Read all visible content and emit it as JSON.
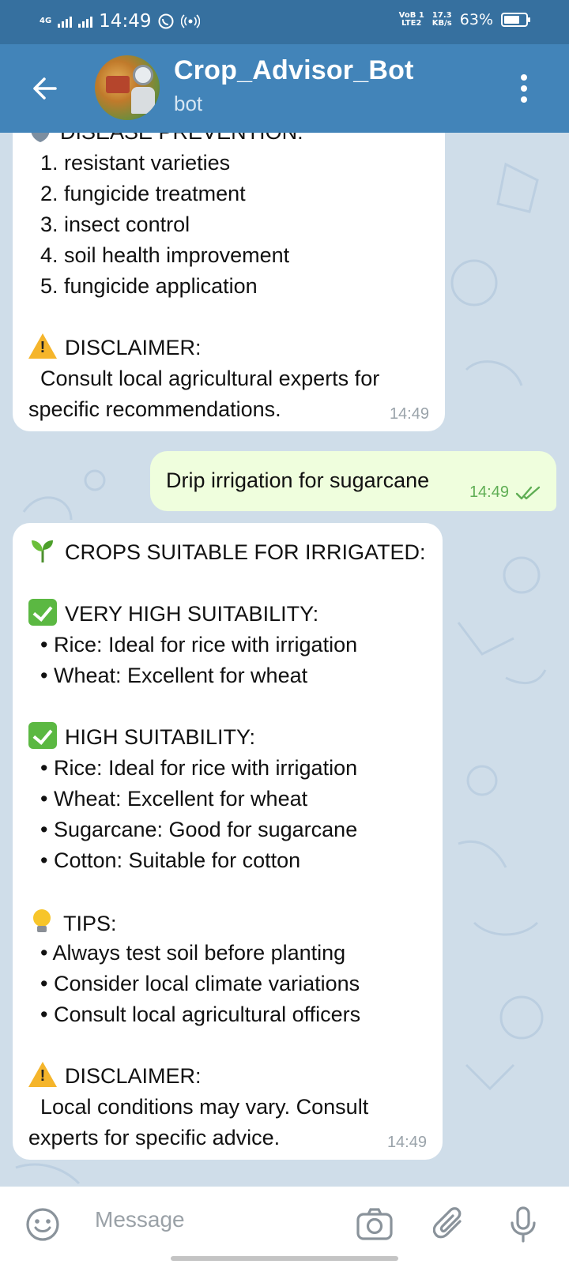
{
  "status_bar": {
    "network": "4G",
    "time": "14:49",
    "volte": "VoB 1",
    "lte": "LTE2",
    "speed_value": "17.3",
    "speed_unit": "KB/s",
    "battery": "63%",
    "battery_level": 0.63
  },
  "header": {
    "title": "Crop_Advisor_Bot",
    "subtitle": "bot",
    "back_icon": "arrow-left-icon",
    "menu_icon": "more-vertical-icon"
  },
  "messages": [
    {
      "from": "bot",
      "lines": [
        "DISEASE PREVENTION:",
        "  1. resistant varieties",
        "  2. fungicide treatment",
        "  3. insect control",
        "  4. soil health improvement",
        "  5. fungicide application",
        "",
        "DISCLAIMER:",
        "  Consult local agricultural experts for",
        "specific recommendations."
      ],
      "time": "14:49"
    },
    {
      "from": "user",
      "text": "Drip irrigation for sugarcane",
      "time": "14:49"
    },
    {
      "from": "bot",
      "lines": [
        "CROPS SUITABLE FOR IRRIGATED:",
        "",
        "VERY HIGH SUITABILITY:",
        "  • Rice: Ideal for rice with irrigation",
        "  • Wheat: Excellent for wheat",
        "",
        "HIGH SUITABILITY:",
        "  • Rice: Ideal for rice with irrigation",
        "  • Wheat: Excellent for wheat",
        "  • Sugarcane: Good for sugarcane",
        "  • Cotton: Suitable for cotton",
        "",
        "TIPS:",
        "  • Always test soil before planting",
        "  • Consider local climate variations",
        "  • Consult local agricultural officers",
        "",
        "DISCLAIMER:",
        "  Local conditions may vary. Consult",
        "experts for specific advice."
      ],
      "time": "14:49"
    }
  ],
  "input_bar": {
    "placeholder": "Message",
    "icons": [
      "emoji-icon",
      "camera-icon",
      "attach-icon",
      "microphone-icon"
    ]
  },
  "colors": {
    "status_bar": "#36709f",
    "header": "#4284b9",
    "chat_bg": "#cfdde9",
    "outgoing_bubble": "#effedd",
    "incoming_bubble": "#ffffff",
    "read_check": "#5fae54"
  }
}
